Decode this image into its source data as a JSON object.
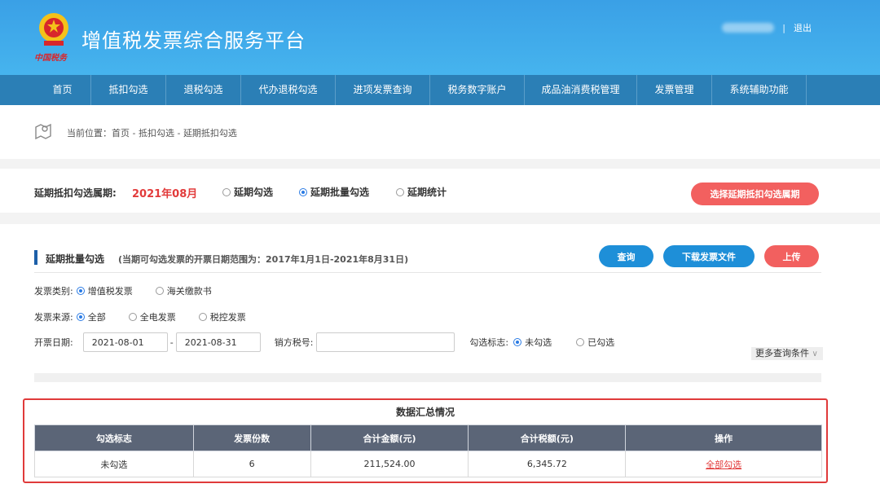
{
  "header": {
    "site_title": "增值税发票综合服务平台",
    "emblem_text": "中国税务",
    "separator": "|",
    "logout": "退出"
  },
  "nav": [
    {
      "label": "首页"
    },
    {
      "label": "抵扣勾选"
    },
    {
      "label": "退税勾选"
    },
    {
      "label": "代办退税勾选"
    },
    {
      "label": "进项发票查询"
    },
    {
      "label": "税务数字账户"
    },
    {
      "label": "成品油消费税管理"
    },
    {
      "label": "发票管理"
    },
    {
      "label": "系统辅助功能"
    }
  ],
  "breadcrumb": {
    "prefix": "当前位置：",
    "items": [
      "首页",
      "抵扣勾选",
      "延期抵扣勾选"
    ],
    "sep": " - "
  },
  "period": {
    "label": "延期抵扣勾选属期:",
    "value": "2021年08月",
    "options": [
      {
        "label": "延期勾选",
        "checked": false
      },
      {
        "label": "延期批量勾选",
        "checked": true
      },
      {
        "label": "延期统计",
        "checked": false
      }
    ],
    "select_button": "选择延期抵扣勾选属期"
  },
  "batch": {
    "title": "延期批量勾选",
    "subtitle": "(当期可勾选发票的开票日期范围为：2017年1月1日-2021年8月31日)",
    "buttons": {
      "query": "查询",
      "download": "下载发票文件",
      "upload": "上传"
    },
    "invoice_type": {
      "label": "发票类别:",
      "options": [
        {
          "label": "增值税发票",
          "checked": true
        },
        {
          "label": "海关缴款书",
          "checked": false
        }
      ]
    },
    "source": {
      "label": "发票来源:",
      "options": [
        {
          "label": "全部",
          "checked": true
        },
        {
          "label": "全电发票",
          "checked": false
        },
        {
          "label": "税控发票",
          "checked": false
        }
      ]
    },
    "date": {
      "label": "开票日期:",
      "start": "2021-08-01",
      "dash": "-",
      "end": "2021-08-31"
    },
    "seller_tax": {
      "label": "销方税号:",
      "value": ""
    },
    "select_flag": {
      "label": "勾选标志:",
      "options": [
        {
          "label": "未勾选",
          "checked": true
        },
        {
          "label": "已勾选",
          "checked": false
        }
      ]
    },
    "more_conditions": "更多查询条件"
  },
  "summary": {
    "title": "数据汇总情况",
    "columns": [
      "勾选标志",
      "发票份数",
      "合计金额(元)",
      "合计税额(元)",
      "操作"
    ],
    "rows": [
      {
        "flag": "未勾选",
        "count": "6",
        "amount": "211,524.00",
        "tax": "6,345.72",
        "action": "全部勾选"
      }
    ]
  },
  "colors": {
    "header_blue": "#3aa0e6",
    "nav_blue": "#2b7fb6",
    "accent_red": "#e23b3b",
    "button_blue": "#1e8fd8",
    "button_red": "#f2605f",
    "table_header": "#5b6577"
  }
}
